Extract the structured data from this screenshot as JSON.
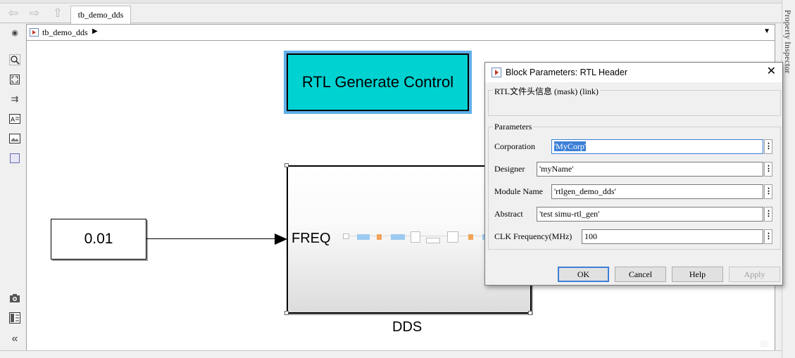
{
  "tabs": {
    "model_tab": "tb_demo_dds"
  },
  "breadcrumb": {
    "model_name": "tb_demo_dds"
  },
  "property_inspector_label": "Property Inspector",
  "canvas": {
    "rtl_control_label": "RTL Generate Control",
    "constant_value": "0.01",
    "dds_port_label": "FREQ",
    "dds_block_label": "DDS"
  },
  "dialog": {
    "title": "Block Parameters: RTL Header",
    "mask_section": "RTL文件头信息 (mask) (link)",
    "params_section": "Parameters",
    "params": [
      {
        "label": "Corporation",
        "value": "'MyCorp'"
      },
      {
        "label": "Designer",
        "value": "'myName'"
      },
      {
        "label": "Module Name",
        "value": "'rtlgen_demo_dds'"
      },
      {
        "label": "Abstract",
        "value": "'test simu-rtl_gen'"
      },
      {
        "label": "CLK Frequency(MHz)",
        "value": "100"
      }
    ],
    "buttons": {
      "ok": "OK",
      "cancel": "Cancel",
      "help": "Help",
      "apply": "Apply"
    }
  },
  "colors": {
    "rtl_block_fill": "#00d2d2",
    "rtl_block_highlight": "#5fb0e8",
    "selection": "#3c7fd6"
  },
  "icons": [
    "back-arrow-icon",
    "forward-arrow-icon",
    "up-arrow-icon",
    "zoom-icon",
    "fit-view-icon",
    "arrow-icon",
    "text-annotation-icon",
    "image-icon",
    "area-icon",
    "camera-icon",
    "model-browser-icon",
    "collapse-icon",
    "close-icon",
    "ellipsis-icon"
  ]
}
